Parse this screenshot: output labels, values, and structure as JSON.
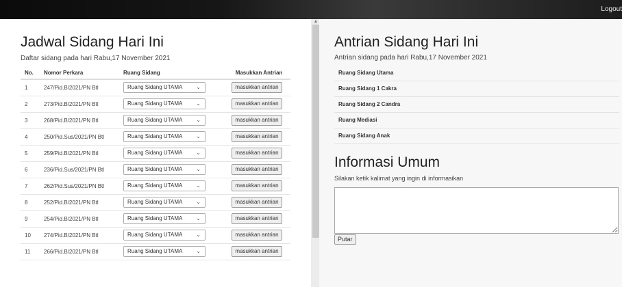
{
  "topbar": {
    "logout_label": "Logout"
  },
  "left": {
    "title": "Jadwal Sidang Hari Ini",
    "subtitle": "Daftar sidang pada hari Rabu,17 November 2021",
    "columns": [
      "No.",
      "Nomor Perkara",
      "Ruang Sidang",
      "Masukkan Antrian"
    ],
    "rows": [
      {
        "no": "1",
        "perkara": "247/Pid.B/2021/PN Btl",
        "ruang": "Ruang Sidang UTAMA",
        "action": "masukkan antrian"
      },
      {
        "no": "2",
        "perkara": "273/Pid.B/2021/PN Btl",
        "ruang": "Ruang Sidang UTAMA",
        "action": "masukkan antrian"
      },
      {
        "no": "3",
        "perkara": "268/Pid.B/2021/PN Btl",
        "ruang": "Ruang Sidang UTAMA",
        "action": "masukkan antrian"
      },
      {
        "no": "4",
        "perkara": "250/Pid.Sus/2021/PN Btl",
        "ruang": "Ruang Sidang UTAMA",
        "action": "masukkan antrian"
      },
      {
        "no": "5",
        "perkara": "259/Pid.B/2021/PN Btl",
        "ruang": "Ruang Sidang UTAMA",
        "action": "masukkan antrian"
      },
      {
        "no": "6",
        "perkara": "236/Pid.Sus/2021/PN Btl",
        "ruang": "Ruang Sidang UTAMA",
        "action": "masukkan antrian"
      },
      {
        "no": "7",
        "perkara": "262/Pid.Sus/2021/PN Btl",
        "ruang": "Ruang Sidang UTAMA",
        "action": "masukkan antrian"
      },
      {
        "no": "8",
        "perkara": "252/Pid.B/2021/PN Btl",
        "ruang": "Ruang Sidang UTAMA",
        "action": "masukkan antrian"
      },
      {
        "no": "9",
        "perkara": "254/Pid.B/2021/PN Btl",
        "ruang": "Ruang Sidang UTAMA",
        "action": "masukkan antrian"
      },
      {
        "no": "10",
        "perkara": "274/Pid.B/2021/PN Btl",
        "ruang": "Ruang Sidang UTAMA",
        "action": "masukkan antrian"
      },
      {
        "no": "11",
        "perkara": "266/Pid.B/2021/PN Btl",
        "ruang": "Ruang Sidang UTAMA",
        "action": "masukkan antrian"
      }
    ]
  },
  "right": {
    "queue_title": "Antrian Sidang Hari Ini",
    "queue_subtitle": "Antrian sidang pada hari Rabu,17 November 2021",
    "rooms": [
      "Ruang Sidang Utama",
      "Ruang Sidang 1 Cakra",
      "Ruang Sidang 2 Candra",
      "Ruang Mediasi",
      "Ruang Sidang Anak"
    ],
    "info_title": "Informasi Umum",
    "info_hint": "Silakan ketik kalimat yang ingin di informasikan",
    "info_value": "",
    "play_label": "Putar"
  },
  "colors": {
    "topbar": "#111111",
    "right_panel": "#f7f7f7",
    "divider": "#ececec"
  },
  "icons": {
    "select_arrow": "chevron-down-icon",
    "scroll_up": "chevron-up-icon"
  }
}
